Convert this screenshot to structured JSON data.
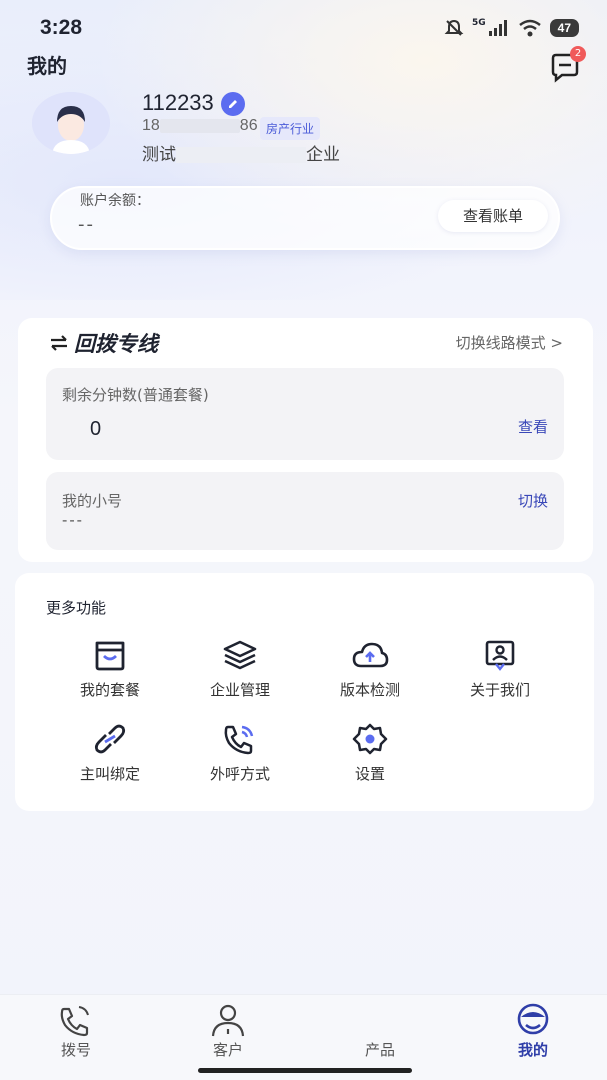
{
  "status_bar": {
    "time": "3:28",
    "battery": "47",
    "network": "5G"
  },
  "header": {
    "title": "我的",
    "message_badge": "2"
  },
  "profile": {
    "username": "112233",
    "phone_prefix": "18",
    "phone_suffix": "86",
    "industry_tag": "房产行业",
    "company_prefix": "测试",
    "company_suffix": "企业"
  },
  "balance": {
    "label": "账户余额：",
    "value": "--",
    "bill_button": "查看账单"
  },
  "callback": {
    "title": "回拨专线",
    "switch_mode": "切换线路模式 >",
    "remaining_label": "剩余分钟数(普通套餐)",
    "remaining_value": "0",
    "view_action": "查看",
    "my_number_label": "我的小号",
    "my_number_value": "---",
    "switch_action": "切换"
  },
  "more": {
    "title": "更多功能",
    "items": [
      {
        "label": "我的套餐",
        "icon": "package-icon"
      },
      {
        "label": "企业管理",
        "icon": "layers-icon"
      },
      {
        "label": "版本检测",
        "icon": "cloud-upload-icon"
      },
      {
        "label": "关于我们",
        "icon": "about-icon"
      },
      {
        "label": "主叫绑定",
        "icon": "link-icon"
      },
      {
        "label": "外呼方式",
        "icon": "phone-call-icon"
      },
      {
        "label": "设置",
        "icon": "settings-icon"
      }
    ]
  },
  "tabbar": {
    "items": [
      {
        "label": "拨号",
        "icon": "dial-icon"
      },
      {
        "label": "客户",
        "icon": "customer-icon"
      },
      {
        "label": "产品",
        "icon": "product-icon"
      },
      {
        "label": "我的",
        "icon": "mine-icon",
        "active": true
      }
    ]
  },
  "colors": {
    "accent": "#2f3ea8",
    "tag_bg": "#e6e8fb",
    "badge": "#f05a5a"
  }
}
